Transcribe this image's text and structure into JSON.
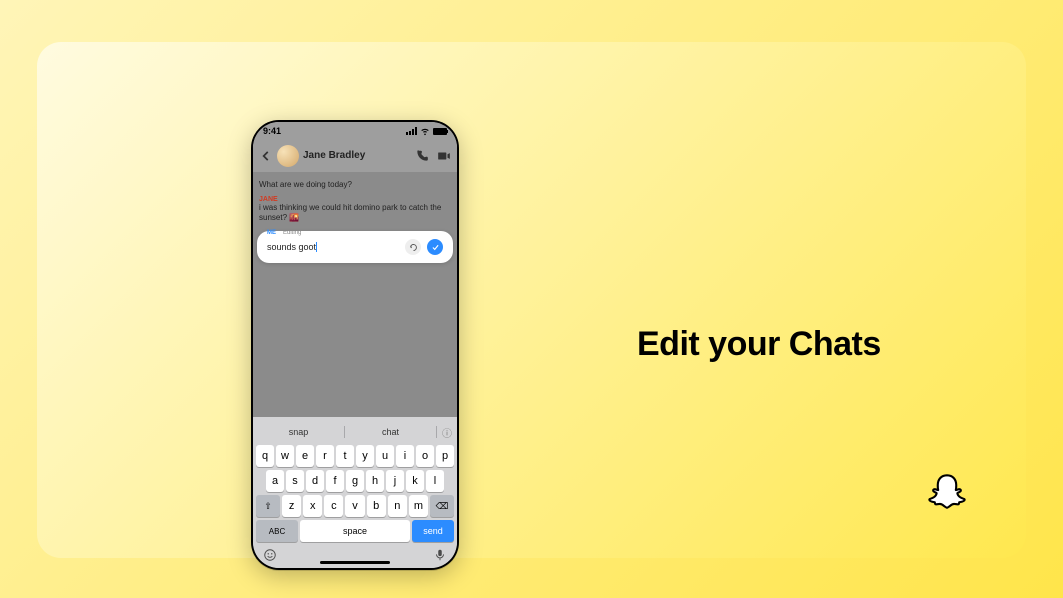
{
  "headline": "Edit your Chats",
  "phone": {
    "status": {
      "time": "9:41"
    },
    "header": {
      "contact_name": "Jane Bradley",
      "contact_sub": ""
    },
    "messages": {
      "incoming1": "What are we doing today?",
      "sender_label": "JANE",
      "incoming2": "i was thinking we could hit domino park to catch the sunset? 🌇",
      "edit_label": "ME",
      "edit_sub": "Editing",
      "edit_text": "sounds goot"
    },
    "suggestions": {
      "left": "snap",
      "right": "chat"
    },
    "keyboard": {
      "row1": [
        "q",
        "w",
        "e",
        "r",
        "t",
        "y",
        "u",
        "i",
        "o",
        "p"
      ],
      "row2": [
        "a",
        "s",
        "d",
        "f",
        "g",
        "h",
        "j",
        "k",
        "l"
      ],
      "row3": [
        "z",
        "x",
        "c",
        "v",
        "b",
        "n",
        "m"
      ],
      "shift": "⇧",
      "backspace": "⌫",
      "abc": "ABC",
      "space": "space",
      "send": "send"
    }
  }
}
